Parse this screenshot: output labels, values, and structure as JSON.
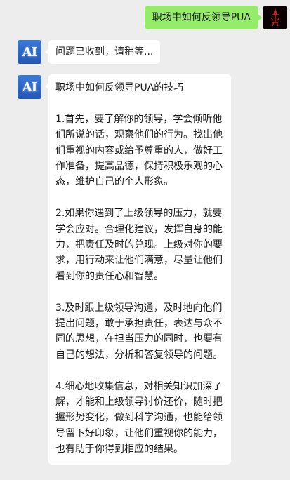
{
  "user_message": {
    "text": "职场中如何反领导PUA"
  },
  "bot_avatar": {
    "label": "AI",
    "color": "#2d66c7"
  },
  "bot_messages": {
    "status": "问题已收到，请稍等...",
    "answer": {
      "title": "职场中如何反领导PUA的技巧",
      "paragraphs": [
        "1.首先，要了解你的领导，学会倾听他们所说的话，观察他们的行为。找出他们重视的内容或给予尊重的人，做好工作准备，提高品德，保持积极乐观的心态，维护自己的个人形象。",
        "2.如果你遇到了上级领导的压力，就要学会应对。合理化建议，发挥自身的能力，把责任及时的兑现。上级对你的要求，用行动来让他们满意，尽量让他们看到你的责任心和智慧。",
        "3.及时跟上级领导沟通，及时地向他们提出问题，敢于承担责任，表达与众不同的思想，在担当压力的同时，也要有自己的想法，分析和答复领导的问题。",
        "4.细心地收集信息，对相关知识加深了解，才能和上级领导讨价还价，随时把握形势变化，做到科学沟通，也能给领导留下好印象，让他们重视你的能力，也有助于你得到相应的结果。"
      ]
    }
  },
  "colors": {
    "background": "#ededed",
    "user_bubble": "#95ec69",
    "bot_bubble": "#ffffff"
  }
}
